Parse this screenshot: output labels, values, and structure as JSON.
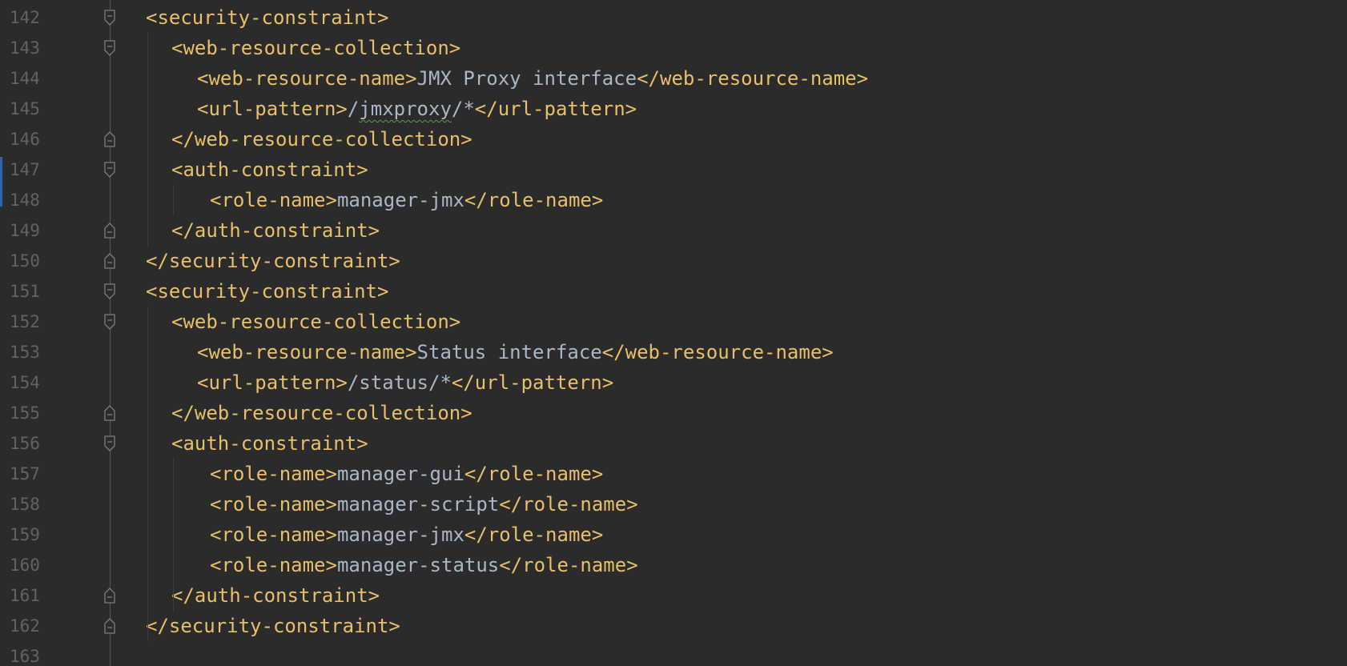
{
  "editor": {
    "colors": {
      "background": "#2b2b2b",
      "tag": "#e8bf6a",
      "text": "#a9b7c6",
      "line_number": "#606366",
      "typo_underline": "#5b9c4a"
    },
    "lines": [
      {
        "number": "142",
        "indent": 0,
        "fold": "open",
        "parts": [
          {
            "kind": "tag",
            "text": "<security-constraint>"
          }
        ]
      },
      {
        "number": "143",
        "indent": 1,
        "fold": "open",
        "parts": [
          {
            "kind": "tag",
            "text": "<web-resource-collection>"
          }
        ]
      },
      {
        "number": "144",
        "indent": 2,
        "fold": "none",
        "parts": [
          {
            "kind": "tag",
            "text": "<web-resource-name>"
          },
          {
            "kind": "txt",
            "text": "JMX Proxy interface"
          },
          {
            "kind": "tag",
            "text": "</web-resource-name>"
          }
        ]
      },
      {
        "number": "145",
        "indent": 2,
        "fold": "none",
        "parts": [
          {
            "kind": "tag",
            "text": "<url-pattern>"
          },
          {
            "kind": "txt",
            "text": "/"
          },
          {
            "kind": "txt",
            "text": "jmxproxy",
            "typo": true
          },
          {
            "kind": "txt",
            "text": "/*"
          },
          {
            "kind": "tag",
            "text": "</url-pattern>"
          }
        ]
      },
      {
        "number": "146",
        "indent": 1,
        "fold": "close",
        "parts": [
          {
            "kind": "tag",
            "text": "</web-resource-collection>"
          }
        ]
      },
      {
        "number": "147",
        "indent": 1,
        "fold": "open",
        "parts": [
          {
            "kind": "tag",
            "text": "<auth-constraint>"
          }
        ]
      },
      {
        "number": "148",
        "indent": 2.5,
        "fold": "none",
        "parts": [
          {
            "kind": "tag",
            "text": "<role-name>"
          },
          {
            "kind": "txt",
            "text": "manager-jmx"
          },
          {
            "kind": "tag",
            "text": "</role-name>"
          }
        ]
      },
      {
        "number": "149",
        "indent": 1,
        "fold": "close",
        "parts": [
          {
            "kind": "tag",
            "text": "</auth-constraint>"
          }
        ]
      },
      {
        "number": "150",
        "indent": 0,
        "fold": "close",
        "parts": [
          {
            "kind": "tag",
            "text": "</security-constraint>"
          }
        ]
      },
      {
        "number": "151",
        "indent": 0,
        "fold": "open",
        "parts": [
          {
            "kind": "tag",
            "text": "<security-constraint>"
          }
        ]
      },
      {
        "number": "152",
        "indent": 1,
        "fold": "open",
        "parts": [
          {
            "kind": "tag",
            "text": "<web-resource-collection>"
          }
        ]
      },
      {
        "number": "153",
        "indent": 2,
        "fold": "none",
        "parts": [
          {
            "kind": "tag",
            "text": "<web-resource-name>"
          },
          {
            "kind": "txt",
            "text": "Status interface"
          },
          {
            "kind": "tag",
            "text": "</web-resource-name>"
          }
        ]
      },
      {
        "number": "154",
        "indent": 2,
        "fold": "none",
        "parts": [
          {
            "kind": "tag",
            "text": "<url-pattern>"
          },
          {
            "kind": "txt",
            "text": "/status/*"
          },
          {
            "kind": "tag",
            "text": "</url-pattern>"
          }
        ]
      },
      {
        "number": "155",
        "indent": 1,
        "fold": "close",
        "parts": [
          {
            "kind": "tag",
            "text": "</web-resource-collection>"
          }
        ]
      },
      {
        "number": "156",
        "indent": 1,
        "fold": "open",
        "parts": [
          {
            "kind": "tag",
            "text": "<auth-constraint>"
          }
        ]
      },
      {
        "number": "157",
        "indent": 2.5,
        "fold": "none",
        "parts": [
          {
            "kind": "tag",
            "text": "<role-name>"
          },
          {
            "kind": "txt",
            "text": "manager-gui"
          },
          {
            "kind": "tag",
            "text": "</role-name>"
          }
        ]
      },
      {
        "number": "158",
        "indent": 2.5,
        "fold": "none",
        "parts": [
          {
            "kind": "tag",
            "text": "<role-name>"
          },
          {
            "kind": "txt",
            "text": "manager-script"
          },
          {
            "kind": "tag",
            "text": "</role-name>"
          }
        ]
      },
      {
        "number": "159",
        "indent": 2.5,
        "fold": "none",
        "parts": [
          {
            "kind": "tag",
            "text": "<role-name>"
          },
          {
            "kind": "txt",
            "text": "manager-jmx"
          },
          {
            "kind": "tag",
            "text": "</role-name>"
          }
        ]
      },
      {
        "number": "160",
        "indent": 2.5,
        "fold": "none",
        "parts": [
          {
            "kind": "tag",
            "text": "<role-name>"
          },
          {
            "kind": "txt",
            "text": "manager-status"
          },
          {
            "kind": "tag",
            "text": "</role-name>"
          }
        ]
      },
      {
        "number": "161",
        "indent": 1,
        "fold": "close",
        "parts": [
          {
            "kind": "tag",
            "text": "</auth-constraint>"
          }
        ]
      },
      {
        "number": "162",
        "indent": 0,
        "fold": "close",
        "parts": [
          {
            "kind": "tag",
            "text": "</security-constraint>"
          }
        ]
      },
      {
        "number": "163",
        "indent": 0,
        "fold": "none",
        "parts": []
      }
    ]
  }
}
